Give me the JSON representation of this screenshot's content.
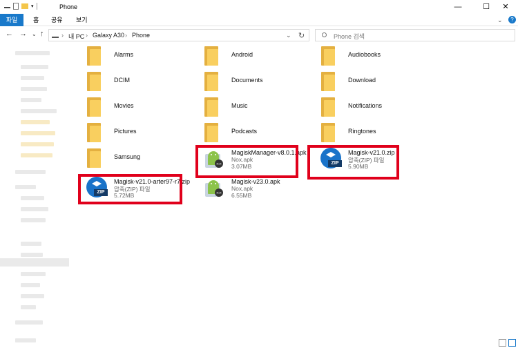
{
  "window": {
    "title": "Phone",
    "minimize": "—",
    "maximize": "☐",
    "close": "✕"
  },
  "ribbon": {
    "tabs": [
      "파일",
      "홈",
      "공유",
      "보기"
    ],
    "expand": "⌄",
    "help": "?"
  },
  "nav": {
    "back": "←",
    "forward": "→",
    "dropdown": "⌄",
    "up": "↑",
    "refresh": "↻"
  },
  "address": {
    "sep": "›",
    "crumbs": [
      "내 PC",
      "Galaxy A30",
      "Phone"
    ]
  },
  "search": {
    "placeholder": "Phone 검색"
  },
  "folders": [
    "Alarms",
    "Android",
    "Audiobooks",
    "DCIM",
    "Documents",
    "Download",
    "Movies",
    "Music",
    "Notifications",
    "Pictures",
    "Podcasts",
    "Ringtones",
    "Samsung"
  ],
  "files": [
    {
      "name": "MagiskManager-v8.0.1.apk",
      "type": "Nox.apk",
      "size": "3.07MB",
      "icon": "apk-icon"
    },
    {
      "name": "Magisk-v21.0.zip",
      "type": "압축(ZIP) 파일",
      "size": "5.90MB",
      "icon": "zip-icon"
    },
    {
      "name": "Magisk-v21.0-arter97-r7.zip",
      "type": "압축(ZIP) 파일",
      "size": "5.72MB",
      "icon": "zip-icon"
    },
    {
      "name": "Magisk-v23.0.apk",
      "type": "Nox.apk",
      "size": "6.55MB",
      "icon": "apk-icon"
    }
  ],
  "zip_badge": "ZIP",
  "colors": {
    "accent": "#1979ca",
    "highlight": "#e0001b",
    "folder": "#f9cf5f",
    "zip": "#1a73c9"
  }
}
